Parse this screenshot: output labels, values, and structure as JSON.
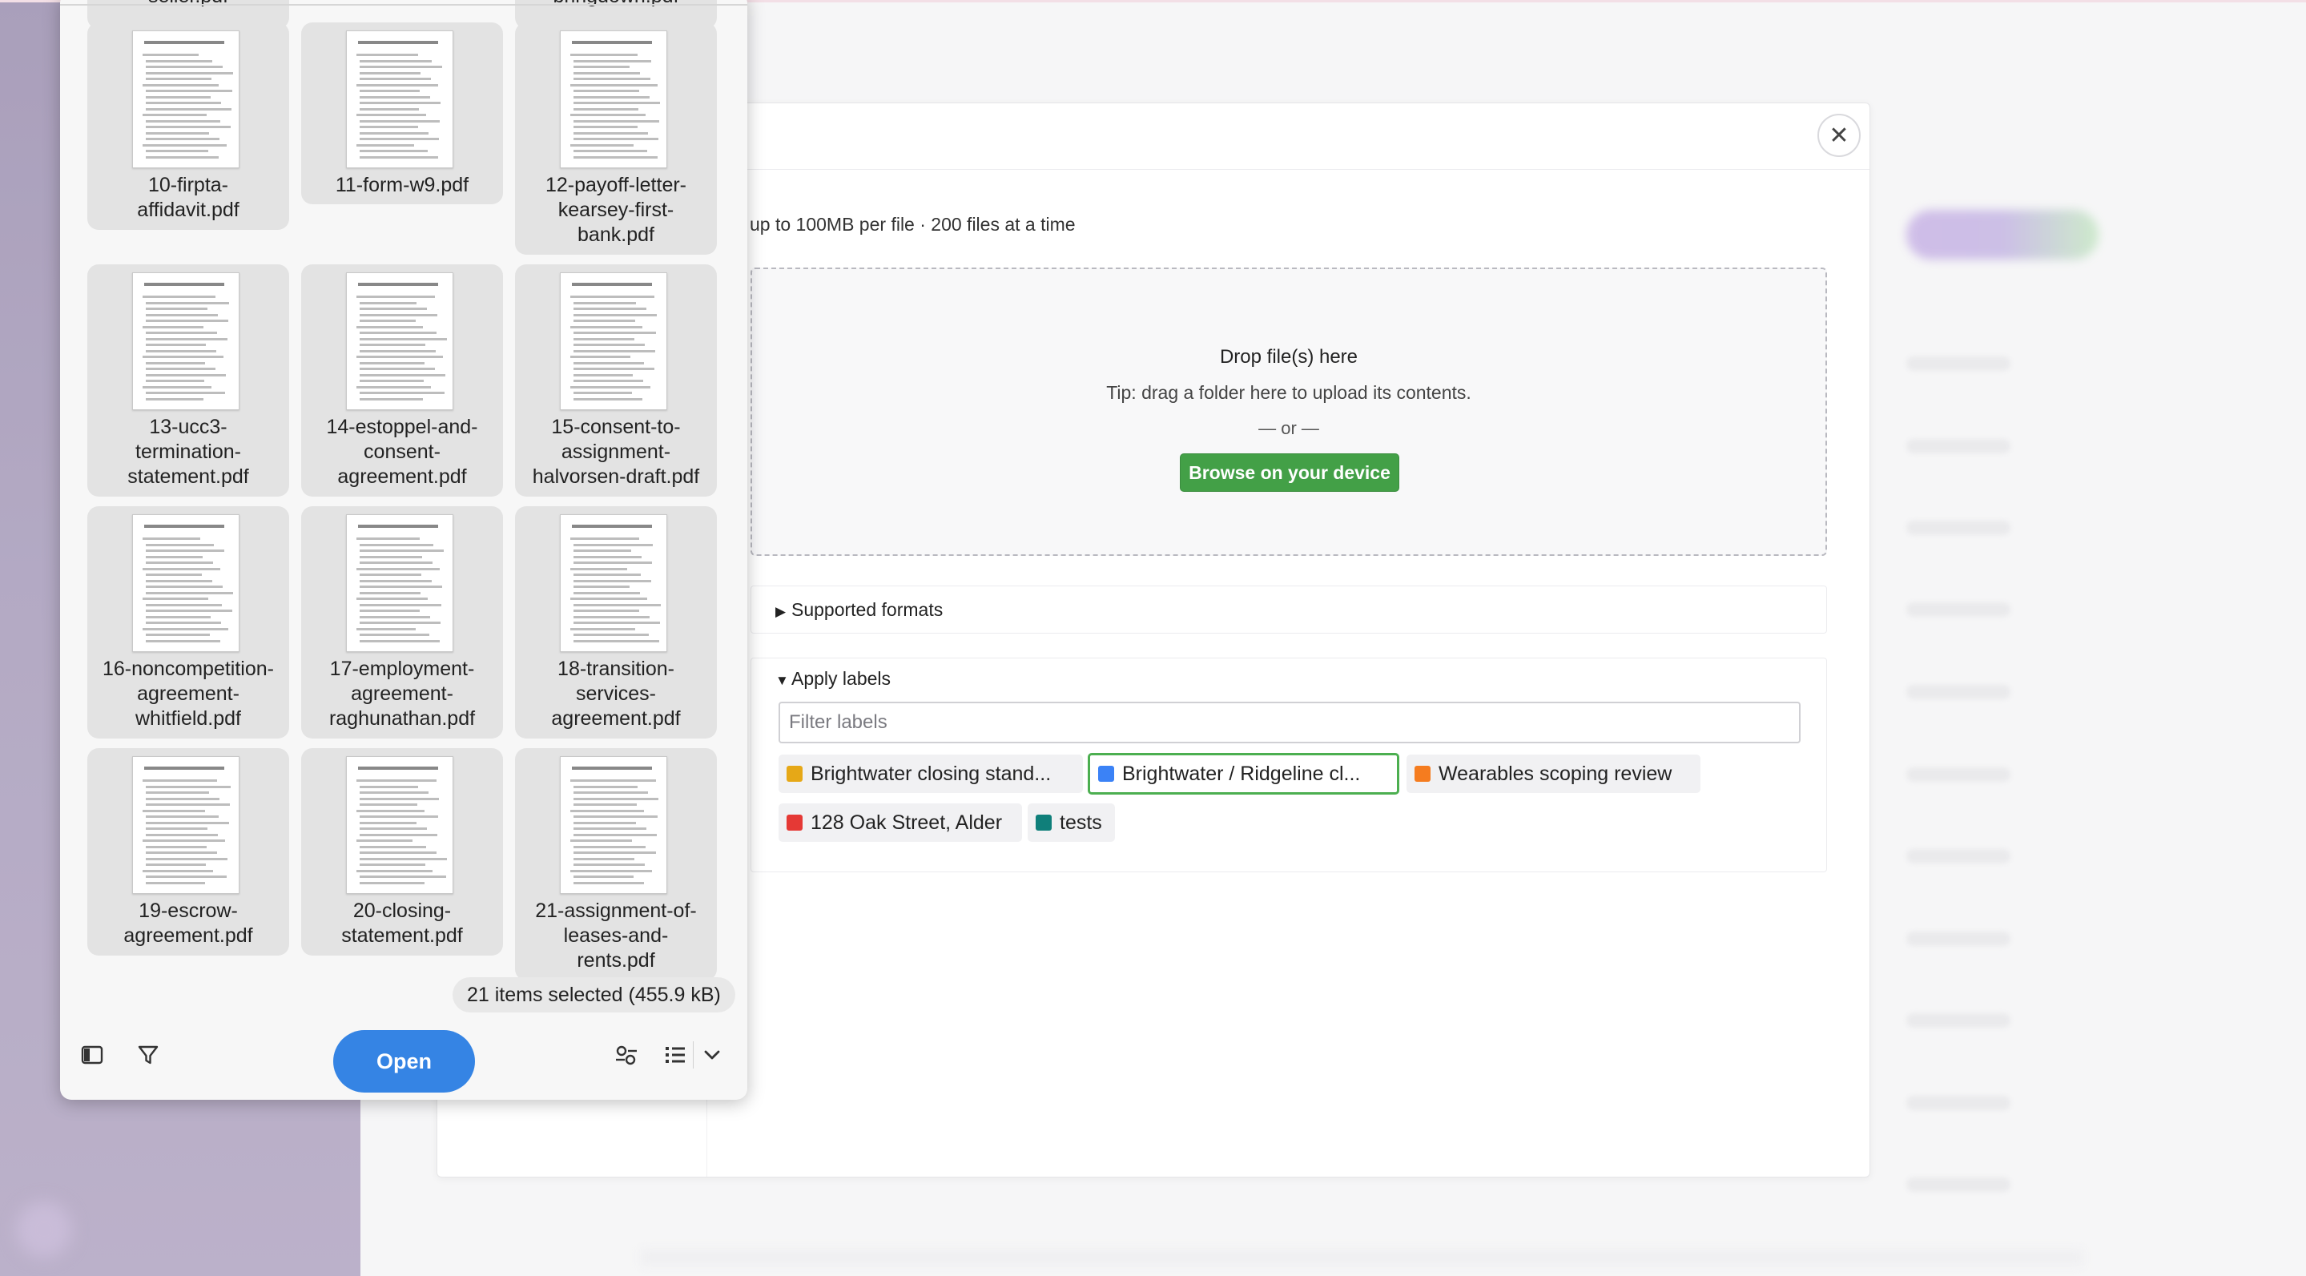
{
  "upload_modal": {
    "limits_text": "up to 100MB per file · 200 files at a time",
    "close_glyph": "✕",
    "dropzone": {
      "title": "Drop file(s) here",
      "tip": "Tip: drag a folder here to upload its contents.",
      "or_text": "— or —",
      "browse_label": "Browse on your device"
    },
    "supported_formats": {
      "label": "Supported formats",
      "expanded": false,
      "marker": "▶"
    },
    "apply_labels": {
      "label": "Apply labels",
      "expanded": true,
      "marker": "▼",
      "filter_placeholder": "Filter labels",
      "filter_value": "",
      "labels": [
        {
          "name": "Brightwater closing stand...",
          "color": "#e6a817",
          "selected": false
        },
        {
          "name": "Brightwater / Ridgeline cl...",
          "color": "#3b82f6",
          "selected": true
        },
        {
          "name": "Wearables scoping review",
          "color": "#f57c1f",
          "selected": false
        },
        {
          "name": "128 Oak Street, Alder",
          "color": "#e53935",
          "selected": false
        },
        {
          "name": "tests",
          "color": "#0f7f7a",
          "selected": false
        }
      ]
    },
    "accent_color": "#43a047"
  },
  "file_chooser": {
    "top_partial_files": [
      "seller.pdf",
      "bringdown.pdf"
    ],
    "files": [
      {
        "name": "10-firpta-affidavit.pdf",
        "lines": [
          "10-firpta-",
          "affidavit.pdf"
        ]
      },
      {
        "name": "11-form-w9.pdf",
        "lines": [
          "11-form-w9.pdf"
        ]
      },
      {
        "name": "12-payoff-letter-kearsey-first-bank.pdf",
        "lines": [
          "12-payoff-letter-",
          "kearsey-first-",
          "bank.pdf"
        ]
      },
      {
        "name": "13-ucc3-termination-statement.pdf",
        "lines": [
          "13-ucc3-",
          "termination-",
          "statement.pdf"
        ]
      },
      {
        "name": "14-estoppel-and-consent-agreement.pdf",
        "lines": [
          "14-estoppel-and-",
          "consent-",
          "agreement.pdf"
        ]
      },
      {
        "name": "15-consent-to-assignment-halvorsen-draft.pdf",
        "lines": [
          "15-consent-to-",
          "assignment-",
          "halvorsen-draft.pdf"
        ]
      },
      {
        "name": "16-noncompetition-agreement-whitfield.pdf",
        "lines": [
          "16-noncompetition-",
          "agreement-",
          "whitfield.pdf"
        ]
      },
      {
        "name": "17-employment-agreement-raghunathan.pdf",
        "lines": [
          "17-employment-",
          "agreement-",
          "raghunathan.pdf"
        ]
      },
      {
        "name": "18-transition-services-agreement.pdf",
        "lines": [
          "18-transition-",
          "services-",
          "agreement.pdf"
        ]
      },
      {
        "name": "19-escrow-agreement.pdf",
        "lines": [
          "19-escrow-",
          "agreement.pdf"
        ]
      },
      {
        "name": "20-closing-statement.pdf",
        "lines": [
          "20-closing-",
          "statement.pdf"
        ]
      },
      {
        "name": "21-assignment-of-leases-and-rents.pdf",
        "lines": [
          "21-assignment-of-",
          "leases-and-",
          "rents.pdf"
        ]
      }
    ],
    "selection_status": "21 items selected  (455.9 kB)",
    "open_label": "Open",
    "footer_icons": [
      "sidebar-toggle-icon",
      "filter-icon",
      "preview-options-icon",
      "list-view-icon",
      "chevron-down-icon"
    ],
    "open_button_color": "#3584e4"
  }
}
